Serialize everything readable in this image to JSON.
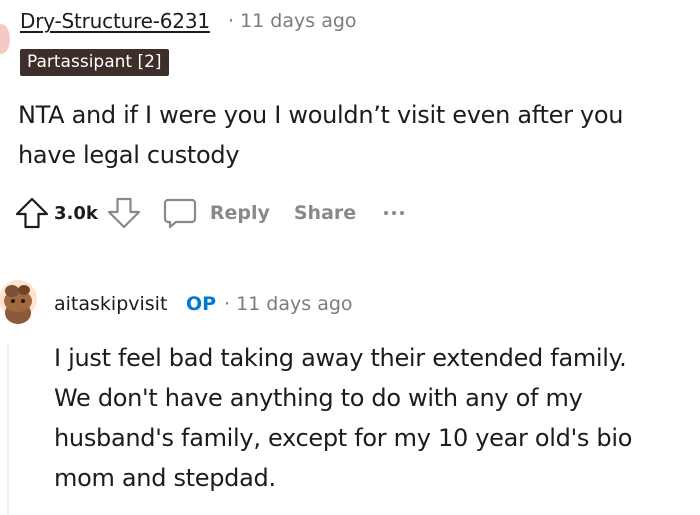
{
  "top_comment": {
    "username": "Dry-Structure-6231",
    "separator": "·",
    "time_ago": "11 days ago",
    "flair": "Partassipant [2]",
    "body": "NTA and if I were you I wouldn’t visit even after you have legal custody"
  },
  "actions": {
    "vote_count": "3.0k",
    "reply_label": "Reply",
    "share_label": "Share"
  },
  "reply_comment": {
    "username": "aitaskipvisit",
    "op_badge": "OP",
    "separator": "·",
    "time_ago": "11 days ago",
    "body_lines": [
      "I just feel bad taking away their extended family.",
      "We don't have anything to do with any of my",
      "husband's family, except for my 10 year old's bio",
      "mom and stepdad."
    ]
  },
  "icons": {
    "upvote": "upvote-arrow-icon",
    "downvote": "downvote-arrow-icon",
    "comment": "speech-bubble-icon",
    "more": "horizontal-ellipsis-icon",
    "avatar": "snoo-avatar-icon"
  },
  "colors": {
    "text": "#1c1c1c",
    "meta": "#7c7c7c",
    "action_gray": "#878a8c",
    "flair_bg": "#3e2e2a",
    "op_blue": "#0079d3"
  }
}
